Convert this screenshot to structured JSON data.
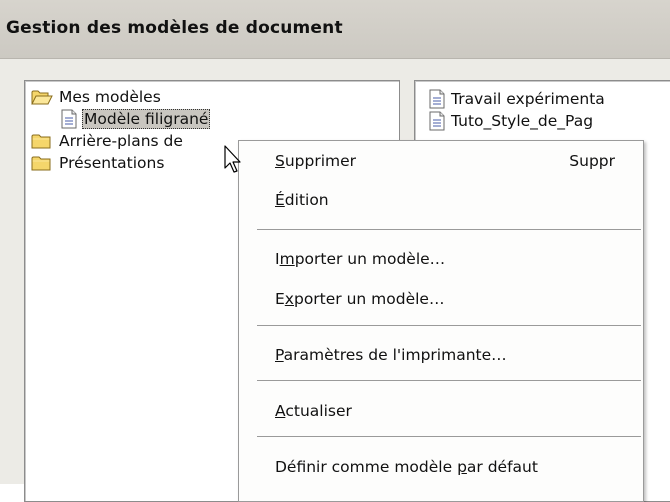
{
  "dialog": {
    "title": "Gestion des modèles de document"
  },
  "left_tree": {
    "items": [
      {
        "label": "Mes modèles",
        "icon": "open-folder-icon"
      },
      {
        "label": "Modèle filigrané",
        "icon": "document-icon",
        "selected": true
      },
      {
        "label": "Arrière-plans de",
        "icon": "folder-icon"
      },
      {
        "label": "Présentations",
        "icon": "folder-icon"
      }
    ]
  },
  "right_list": {
    "items": [
      {
        "label": "Travail expérimenta",
        "icon": "document-icon"
      },
      {
        "label": "Tuto_Style_de_Pag",
        "icon": "document-icon"
      }
    ]
  },
  "context_menu": {
    "delete": {
      "pre": "",
      "u": "S",
      "post": "upprimer",
      "shortcut": "Suppr"
    },
    "edit": {
      "pre": "",
      "u": "É",
      "post": "dition"
    },
    "import": {
      "pre": "I",
      "u": "m",
      "post": "porter un modèle…"
    },
    "export": {
      "pre": "E",
      "u": "x",
      "post": "porter un modèle…"
    },
    "printer": {
      "pre": "",
      "u": "P",
      "post": "aramètres de l'imprimante…"
    },
    "refresh": {
      "pre": "",
      "u": "A",
      "post": "ctualiser"
    },
    "default": {
      "pre": "Définir comme modèle ",
      "u": "p",
      "post": "ar défaut"
    }
  },
  "colors": {
    "selection_bg": "#c9c6c0",
    "folder": "#f5d66b",
    "doc_lines": "#4a5ea8"
  }
}
